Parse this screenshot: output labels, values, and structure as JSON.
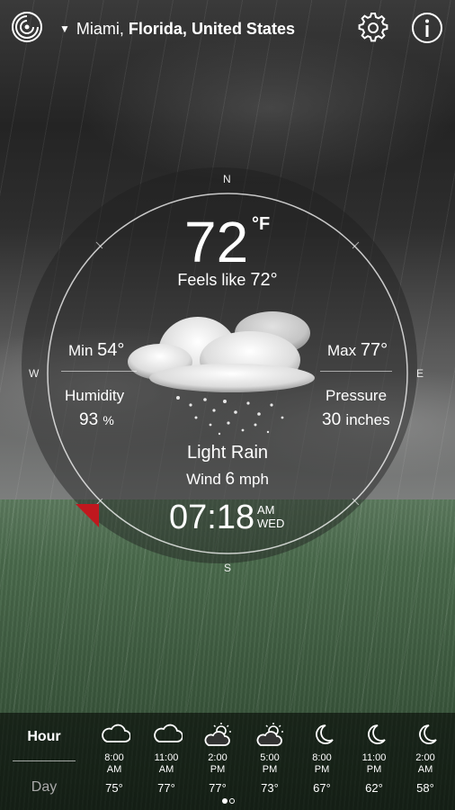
{
  "location": {
    "city": "Miami,",
    "region": "Florida,",
    "country": "United States"
  },
  "current": {
    "temperature": "72",
    "unit": "°F",
    "feels_like_label": "Feels like",
    "feels_like_value": "72°",
    "min_label": "Min",
    "min_value": "54°",
    "max_label": "Max",
    "max_value": "77°",
    "humidity_label": "Humidity",
    "humidity_value": "93",
    "humidity_unit": "%",
    "pressure_label": "Pressure",
    "pressure_value": "30",
    "pressure_unit": "inches",
    "condition": "Light Rain",
    "condition_icon": "rain-cloud-icon",
    "wind_label": "Wind",
    "wind_value": "6",
    "wind_unit": "mph",
    "time": "07:18",
    "ampm": "AM",
    "weekday": "WED"
  },
  "compass": {
    "n": "N",
    "s": "S",
    "w": "W",
    "e": "E"
  },
  "tabs": {
    "hour": "Hour",
    "day": "Day"
  },
  "forecast": [
    {
      "time": "8:00",
      "period": "AM",
      "temp": "75°",
      "icon": "cloudy-icon"
    },
    {
      "time": "11:00",
      "period": "AM",
      "temp": "77°",
      "icon": "cloudy-icon"
    },
    {
      "time": "2:00",
      "period": "PM",
      "temp": "77°",
      "icon": "partly-sunny-icon"
    },
    {
      "time": "5:00",
      "period": "PM",
      "temp": "73°",
      "icon": "partly-sunny-icon"
    },
    {
      "time": "8:00",
      "period": "PM",
      "temp": "67°",
      "icon": "moon-icon"
    },
    {
      "time": "11:00",
      "period": "PM",
      "temp": "62°",
      "icon": "moon-icon"
    },
    {
      "time": "2:00",
      "period": "AM",
      "temp": "58°",
      "icon": "moon-icon"
    }
  ],
  "pager": {
    "pages": 2,
    "active": 1
  },
  "colors": {
    "marker": "#c0181e",
    "panel": "#000000"
  }
}
